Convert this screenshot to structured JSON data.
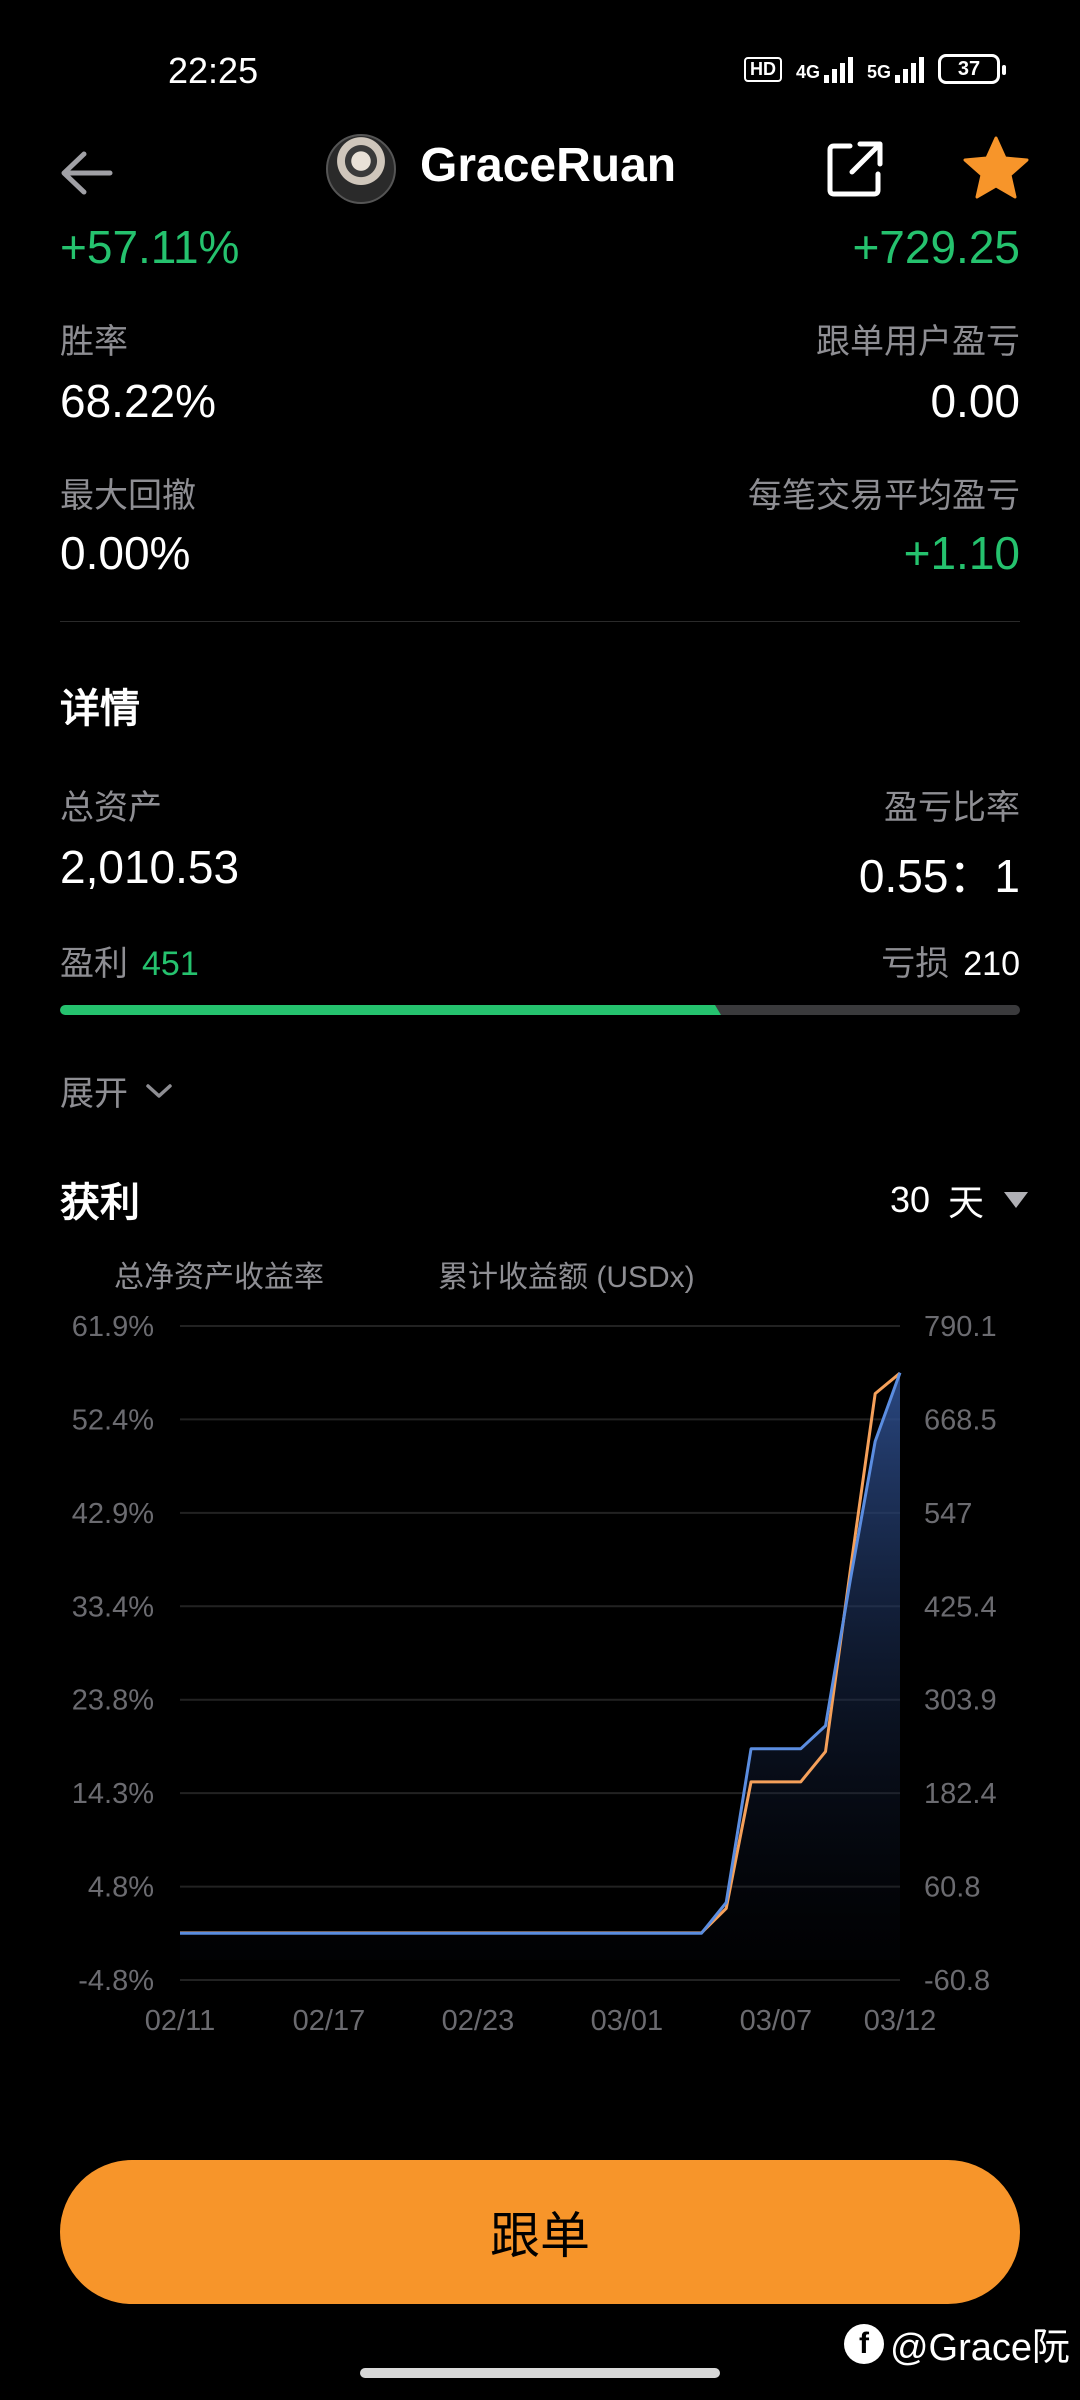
{
  "status_bar": {
    "time": "22:25",
    "battery": "37",
    "hd": "HD",
    "net1": "4G",
    "net2": "5G"
  },
  "header": {
    "username": "GraceRuan"
  },
  "summary": {
    "roi": "+57.11%",
    "pnl": "+729.25",
    "win_rate_label": "胜率",
    "win_rate": "68.22%",
    "follower_pnl_label": "跟单用户盈亏",
    "follower_pnl": "0.00",
    "max_drawdown_label": "最大回撤",
    "max_drawdown": "0.00%",
    "avg_pnl_label": "每笔交易平均盈亏",
    "avg_pnl": "+1.10"
  },
  "details": {
    "title": "详情",
    "total_assets_label": "总资产",
    "total_assets": "2,010.53",
    "pl_ratio_label": "盈亏比率",
    "pl_ratio": "0.55：1",
    "profit_label": "盈利",
    "profit_count": "451",
    "loss_label": "亏损",
    "loss_count": "210",
    "profit_fraction": 0.682,
    "expand_label": "展开"
  },
  "profit_section": {
    "title": "获利",
    "period_value": "30",
    "period_unit": "天"
  },
  "chart_data": {
    "type": "line",
    "legend": [
      "总净资产收益率",
      "累计收益额 (USDx)"
    ],
    "y_left_ticks": [
      "61.9%",
      "52.4%",
      "42.9%",
      "33.4%",
      "23.8%",
      "14.3%",
      "4.8%",
      "-4.8%"
    ],
    "y_right_ticks": [
      "790.1",
      "668.5",
      "547",
      "425.4",
      "303.9",
      "182.4",
      "60.8",
      "-60.8"
    ],
    "x_ticks": [
      "02/11",
      "02/17",
      "02/23",
      "03/01",
      "03/07",
      "03/12"
    ],
    "ylim_left": [
      -4.8,
      61.9
    ],
    "ylim_right": [
      -60.8,
      790.1
    ],
    "series": [
      {
        "name": "总净资产收益率",
        "axis": "left",
        "color": "#f5a05a",
        "x": [
          0,
          21,
          22,
          23,
          24,
          25,
          26,
          27,
          28,
          29
        ],
        "y": [
          0,
          0,
          2.5,
          15.4,
          15.4,
          15.4,
          18.5,
          37,
          55,
          57.1
        ]
      },
      {
        "name": "累计收益额 (USDx)",
        "axis": "right",
        "color": "#5b8de0",
        "x": [
          0,
          21,
          22,
          23,
          24,
          25,
          26,
          27,
          28,
          29
        ],
        "y": [
          0,
          0,
          40,
          240,
          240,
          240,
          270,
          460,
          640,
          729.25
        ]
      }
    ],
    "grid": true
  },
  "follow_button": "跟单",
  "watermark": "@Grace阮",
  "colors": {
    "accent": "#f7952a",
    "positive": "#25c26e",
    "line_blue": "#5b8de0",
    "line_orange": "#f5a05a"
  }
}
